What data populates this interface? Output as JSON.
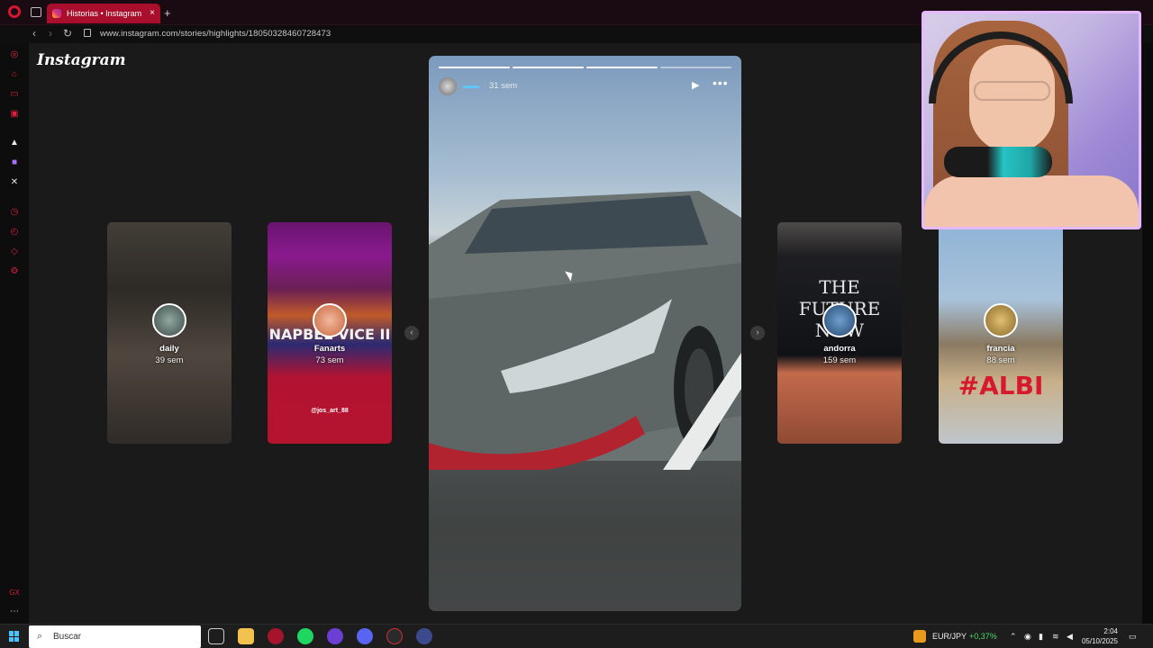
{
  "browser": {
    "tab_title": "Historias • Instagram",
    "tab_close": "×",
    "new_tab": "+",
    "url": "www.instagram.com/stories/highlights/18050328460728473",
    "nav": {
      "back": "‹",
      "forward": "›",
      "reload": "↻"
    }
  },
  "page": {
    "logo": "Instagram",
    "highlights": [
      {
        "name": "daily",
        "time": "39 sem"
      },
      {
        "name": "Fanarts",
        "time": "73 sem",
        "caption": "@jos_art_88",
        "banner_text": "NAPBEL VICE II"
      },
      {
        "name": "andorra",
        "time": "159 sem",
        "banner_text": "THE FUTURE NOW"
      },
      {
        "name": "francia",
        "time": "88 sem",
        "banner_text": "#ALBI"
      }
    ],
    "prev_arrow": "‹",
    "next_arrow": "›",
    "active_story": {
      "time": "31 sem",
      "segments_total": 4,
      "segments_done": 3,
      "play": "▶",
      "more": "•••"
    }
  },
  "taskbar": {
    "search_placeholder": "Buscar",
    "ticker": "EUR/JPY",
    "ticker_change": "+0,37%",
    "time": "2:04",
    "date": "05/10/2025"
  },
  "colors": {
    "opera_red": "#d5172f",
    "tab_active": "#a90f2c",
    "webcam_border": "#e6b8ff",
    "ticker_green": "#4cd964"
  }
}
